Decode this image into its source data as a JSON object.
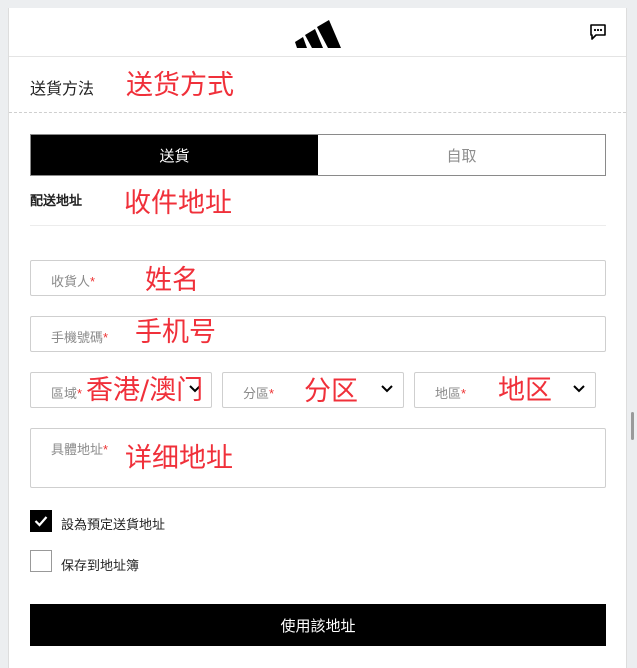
{
  "header": {
    "logo": "adidas-logo",
    "chat_icon": "chat-icon"
  },
  "delivery": {
    "title": "送貨方法",
    "annotation": "送货方式"
  },
  "toggle": {
    "deliver_label": "送貨",
    "pickup_label": "自取"
  },
  "address": {
    "label": "配送地址",
    "annotation": "收件地址"
  },
  "fields": {
    "name": {
      "placeholder": "收貨人",
      "required": "*",
      "annotation": "姓名"
    },
    "phone": {
      "placeholder": "手機號碼",
      "required": "*",
      "annotation": "手机号"
    },
    "area": {
      "placeholder": "區域",
      "required": "*",
      "annotation": "香港/澳门"
    },
    "district": {
      "placeholder": "分區",
      "required": "*",
      "annotation": "分区"
    },
    "region": {
      "placeholder": "地區",
      "required": "*",
      "annotation": "地区"
    },
    "detail": {
      "placeholder": "具體地址",
      "required": "*",
      "annotation": "详细地址"
    }
  },
  "options": {
    "default_label": "設為預定送貨地址",
    "default_checked": true,
    "save_label": "保存到地址簿",
    "save_checked": false
  },
  "submit": {
    "label": "使用該地址"
  },
  "colors": {
    "annotation": "#f0303a",
    "primary": "#000000"
  }
}
